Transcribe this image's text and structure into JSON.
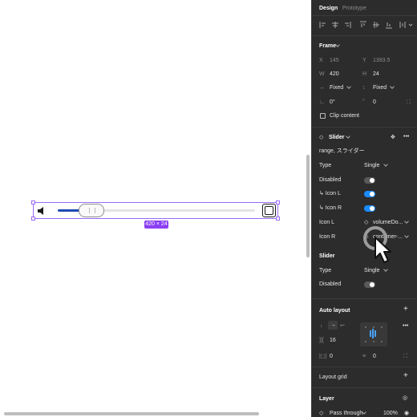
{
  "canvas": {
    "size_badge": "420 × 24"
  },
  "panel": {
    "tabs": {
      "design": "Design",
      "prototype": "Prototype"
    },
    "frame": {
      "title": "Frame",
      "x_label": "X",
      "x_value": "145",
      "y_label": "Y",
      "y_value": "1393.5",
      "w_label": "W",
      "w_value": "420",
      "h_label": "H",
      "h_value": "24",
      "width_mode": "Fixed",
      "height_mode": "Fixed",
      "rotation": "0°",
      "radius": "0",
      "clip_content": "Clip content"
    },
    "component": {
      "name": "Slider",
      "description": "range, スライダー",
      "props": [
        {
          "label": "Type",
          "value": "Single"
        },
        {
          "label": "Disabled"
        },
        {
          "label": "↳ Icon L"
        },
        {
          "label": "↳ Icon R"
        },
        {
          "label": "Icon L",
          "value": "volumeDo..."
        },
        {
          "label": "Icon R",
          "value": "container-..."
        }
      ]
    },
    "nested": {
      "title": "Slider",
      "type_label": "Type",
      "type_value": "Single",
      "disabled_label": "Disabled"
    },
    "auto_layout": {
      "title": "Auto layout",
      "gap": "16",
      "padding_h": "0",
      "padding_v": "0"
    },
    "layout_grid": {
      "title": "Layout grid"
    },
    "layer": {
      "title": "Layer",
      "blend": "Pass through",
      "opacity": "100%"
    }
  },
  "colors": {
    "selection": "#9a6cf7",
    "badge": "#8a3ff3",
    "track_fill": "#1e4bb5",
    "toggle_on": "#1a8cff",
    "panel_bg": "#2c2c2c"
  }
}
